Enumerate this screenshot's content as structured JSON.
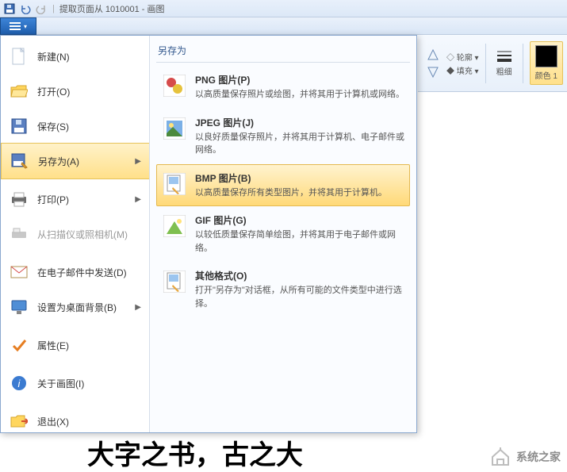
{
  "titlebar": {
    "doc_title": "提取页面从 1010001 - 画图"
  },
  "ribbon": {
    "outline": "轮廓",
    "fill": "填充",
    "stroke_group": "粗细",
    "color1": "颜色 1"
  },
  "left_menu": {
    "new": "新建(N)",
    "open": "打开(O)",
    "save": "保存(S)",
    "saveas": "另存为(A)",
    "print": "打印(P)",
    "scanner": "从扫描仪或照相机(M)",
    "email": "在电子邮件中发送(D)",
    "desktop": "设置为桌面背景(B)",
    "properties": "属性(E)",
    "about": "关于画图(I)",
    "exit": "退出(X)"
  },
  "right_panel": {
    "title": "另存为",
    "png_title": "PNG 图片(P)",
    "png_desc": "以高质量保存照片或绘图，并将其用于计算机或网络。",
    "jpeg_title": "JPEG 图片(J)",
    "jpeg_desc": "以良好质量保存照片，并将其用于计算机、电子邮件或网络。",
    "bmp_title": "BMP 图片(B)",
    "bmp_desc": "以高质量保存所有类型图片，并将其用于计算机。",
    "gif_title": "GIF 图片(G)",
    "gif_desc": "以较低质量保存简单绘图，并将其用于电子邮件或网络。",
    "other_title": "其他格式(O)",
    "other_desc": "打开\"另存为\"对话框，从所有可能的文件类型中进行选择。"
  },
  "canvas": {
    "big_text": "大字之书，古之大"
  },
  "watermark": {
    "text": "系统之家"
  }
}
